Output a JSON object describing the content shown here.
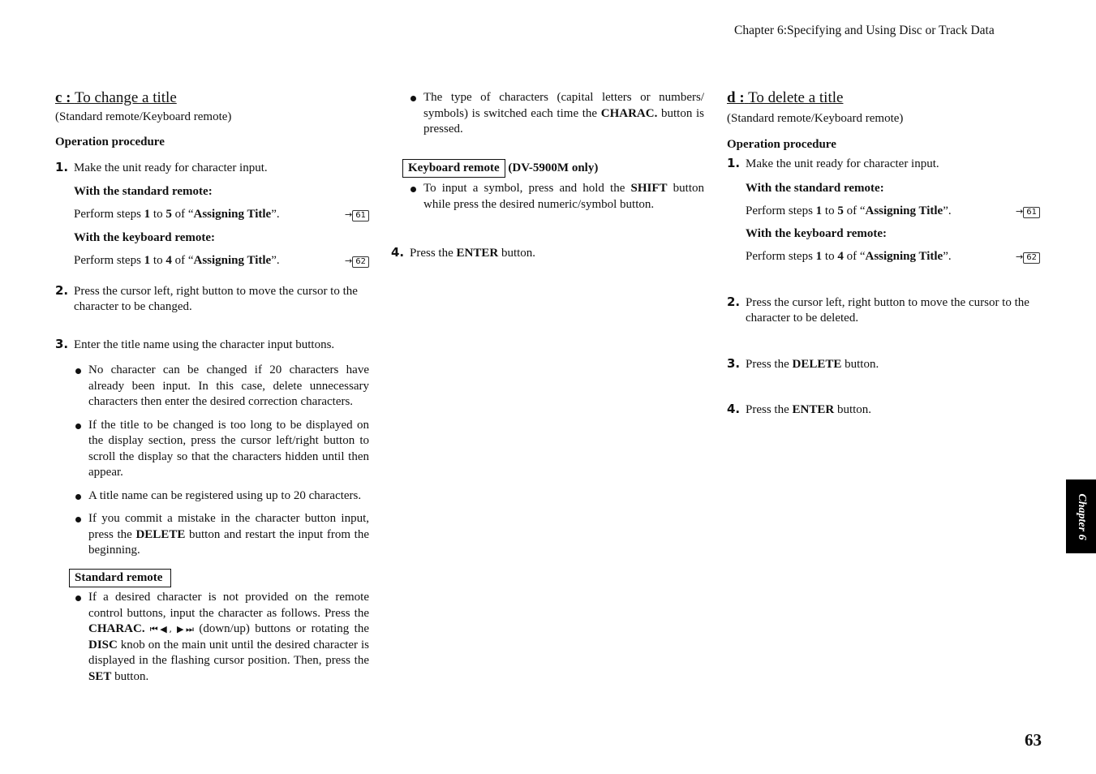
{
  "header": {
    "chapter_title": "Chapter 6:Specifying and Using Disc or Track Data"
  },
  "section_c": {
    "letter": "c :",
    "title": "To change a title",
    "subtitle": "(Standard remote/Keyboard remote)",
    "procedure_heading": "Operation procedure",
    "step1": {
      "num": "1.",
      "text": "Make the unit ready for character input.",
      "standard_label": "With the standard remote:",
      "standard_text": [
        "Perform steps ",
        "1",
        " to ",
        "5",
        " of “",
        "Assigning Title",
        "”."
      ],
      "standard_ref": "61",
      "keyboard_label": "With the keyboard remote:",
      "keyboard_text": [
        "Perform steps ",
        "1",
        " to ",
        "4",
        " of “",
        "Assigning Title",
        "”."
      ],
      "keyboard_ref": "62"
    },
    "step2": {
      "num": "2.",
      "text": "Press the cursor left, right button to move the cursor to the character to be changed."
    },
    "step3": {
      "num": "3.",
      "text": "Enter the title name using the character input buttons.",
      "bullets": [
        "No character can be changed if 20 characters have already been input.  In this case, delete unnecessary characters then enter the desired correction characters.",
        "If the title to be changed is too long to be displayed on the display section, press the cursor left/right button to scroll the display so that the characters hidden until then appear.",
        "A title name can be registered using up to 20 characters."
      ],
      "bullet4": [
        "If you commit a mistake in the character button input, press the ",
        "DELETE",
        " button and restart the input from the beginning."
      ]
    },
    "standard_remote_box": "Standard remote",
    "standard_bullet": [
      "If a desired character is not provided on the remote control buttons, input the character as follows. Press the ",
      "CHARAC.",
      " ⏮◀, ▶⏭",
      " (down/up) buttons or rotating the ",
      "DISC",
      " knob on the main unit until the desired character is displayed in the flashing cursor position. Then, press the ",
      "SET",
      " button."
    ]
  },
  "middle": {
    "bullet1": [
      "The type of characters (capital letters or numbers/ symbols) is switched each time the ",
      "CHARAC.",
      " button is pressed."
    ],
    "keyboard_box": "Keyboard remote",
    "keyboard_suffix": "(DV-5900M only)",
    "bullet2": [
      "To input a symbol, press and hold the ",
      "SHIFT",
      " button while press the desired  numeric/symbol button."
    ],
    "step4": {
      "num": "4.",
      "text": [
        "Press the ",
        "ENTER",
        " button."
      ]
    }
  },
  "section_d": {
    "letter": "d :",
    "title": "To delete a title",
    "subtitle": "(Standard remote/Keyboard remote)",
    "procedure_heading": "Operation procedure",
    "step1": {
      "num": "1.",
      "text": "Make the unit ready for character input.",
      "standard_label": "With the standard remote:",
      "standard_ref": "61",
      "keyboard_label": "With the keyboard remote:",
      "keyboard_ref": "62"
    },
    "step2": {
      "num": "2.",
      "text": "Press the cursor left, right button to move the cursor to the character to be deleted."
    },
    "step3": {
      "num": "3.",
      "text": [
        "Press the ",
        "DELETE",
        " button."
      ]
    },
    "step4": {
      "num": "4.",
      "text": [
        "Press the ",
        "ENTER",
        " button."
      ]
    }
  },
  "side_tab": {
    "label": "Chapter 6"
  },
  "page_number": "63"
}
